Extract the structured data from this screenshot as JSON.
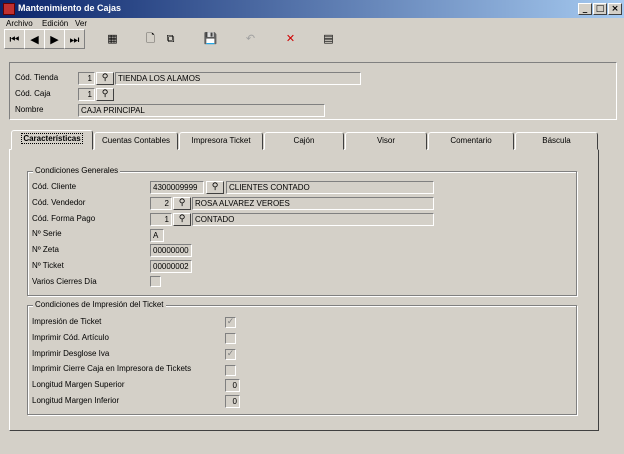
{
  "window": {
    "title": "Mantenimiento de Cajas",
    "buttons": {
      "minimize": "_",
      "maximize": "□",
      "close": "×"
    }
  },
  "menu": [
    "Archivo",
    "Edición",
    "Ver"
  ],
  "toolbar": {
    "icons": [
      "first-icon",
      "prev-icon",
      "next-icon",
      "last-icon",
      "grid-icon",
      "new-icon",
      "copy-icon",
      "save-icon",
      "undo-icon",
      "delete-icon",
      "print-icon"
    ]
  },
  "header": {
    "tienda_label": "Cód. Tienda",
    "tienda_code": "1",
    "tienda_name": "TIENDA LOS ALAMOS",
    "caja_label": "Cód. Caja",
    "caja_code": "1",
    "nombre_label": "Nombre",
    "nombre_value": "CAJA PRINCIPAL"
  },
  "tabs": [
    "Características",
    "Cuentas Contables",
    "Impresora Ticket",
    "Cajón",
    "Visor",
    "Comentario",
    "Báscula"
  ],
  "general": {
    "title": "Condiciones Generales",
    "cliente_label": "Cód. Cliente",
    "cliente_code": "4300009999",
    "cliente_name": "CLIENTES CONTADO",
    "vendedor_label": "Cód. Vendedor",
    "vendedor_code": "2",
    "vendedor_name": "ROSA ALVAREZ VEROES",
    "pago_label": "Cód. Forma Pago",
    "pago_code": "1",
    "pago_name": "CONTADO",
    "serie_label": "Nº Serie",
    "serie_value": "A",
    "zeta_label": "Nº Zeta",
    "zeta_value": "00000000",
    "ticket_label": "Nº Ticket",
    "ticket_value": "00000002",
    "cierres_label": "Varios Cierres Día",
    "cierres_checked": false
  },
  "print": {
    "title": "Condiciones de Impresión del Ticket",
    "impresion_label": "Impresión de Ticket",
    "impresion_checked": true,
    "codart_label": "Imprimir Cód. Artículo",
    "codart_checked": false,
    "iva_label": "Imprimir Desglose Iva",
    "iva_checked": true,
    "cierre_label": "Imprimir Cierre Caja en Impresora de Tickets",
    "cierre_checked": false,
    "sup_label": "Longitud Margen Superior",
    "sup_value": "0",
    "inf_label": "Longitud Margen Inferior",
    "inf_value": "0"
  },
  "glyphs": {
    "search": "⚲",
    "check": "✓"
  }
}
